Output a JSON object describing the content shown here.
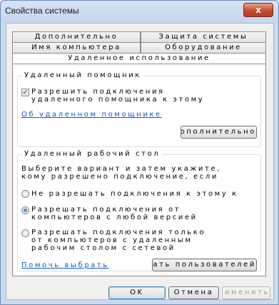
{
  "window": {
    "title": "Свойства системы",
    "close_label": "x"
  },
  "tabs": {
    "row1": [
      "Дополнительно",
      "Защита системы"
    ],
    "row2": [
      "Имя компьютера",
      "Оборудование"
    ],
    "active": "Удаленное использование"
  },
  "assistance": {
    "title": "Удаленный помощник",
    "checkbox_line1": "Разрешить подключения",
    "checkbox_line2": "удаленного помощника к этому",
    "checkbox_checked": true,
    "link": "Об удаленном помощнике",
    "advanced_button": "Дополнительно"
  },
  "desktop": {
    "title": "Удаленный рабочий стол",
    "desc_line1": "Выберите вариант и затем укажите,",
    "desc_line2": "кому разрешено подключение, если",
    "option1": "Не разрешать подключения к этому к",
    "option2_line1": "Разрешать подключения от",
    "option2_line2": "компьютеров с любой версией",
    "option3_line1": "Разрешать подключения только",
    "option3_line2": "от компьютеров с удаленным",
    "option3_line3": "рабочим столом с сетевой",
    "selected_option": 2,
    "help_link": "Помочь выбрать",
    "select_users_button": "Выбрать пользователей"
  },
  "footer": {
    "ok": "OK",
    "cancel": "Отмена",
    "apply": "Применить"
  }
}
